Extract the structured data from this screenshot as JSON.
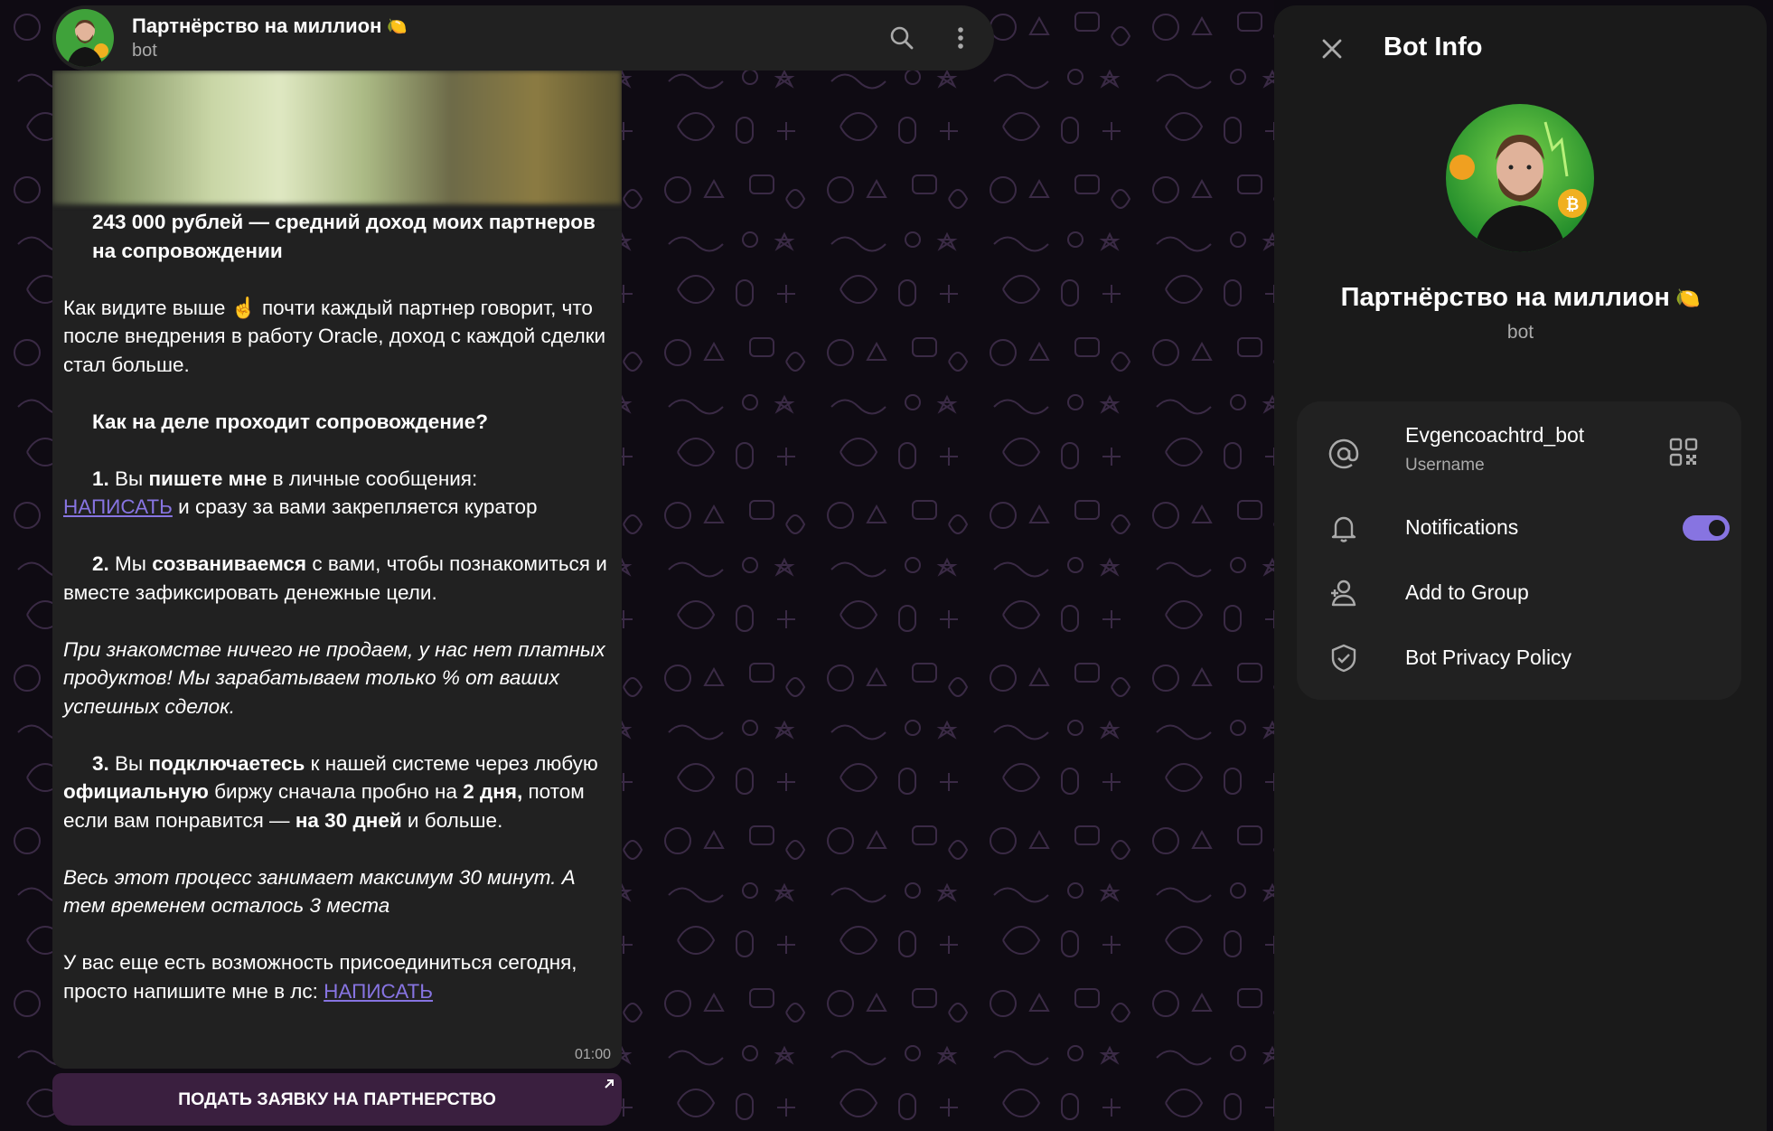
{
  "header": {
    "title": "Партнёрство на миллион",
    "title_emoji": "🍋",
    "subtitle": "bot",
    "icons": [
      "search-icon",
      "more-vertical-icon"
    ]
  },
  "message": {
    "p1": "243 000 рублей — средний доход моих партнеров на сопровождении",
    "p2a": "Как видите выше ",
    "p2_emoji": "☝️",
    "p2b": " почти каждый партнер говорит, что после внедрения в работу Oracle, доход с каждой сделки стал больше.",
    "p3": "Как на деле проходит сопровождение?",
    "p4_num": "1.",
    "p4a": " Вы ",
    "p4_bold": "пишете мне",
    "p4b": " в личные сообщения: ",
    "p4_link": "НАПИСАТЬ",
    "p4c": " и сразу за вами закрепляется куратор",
    "p5_num": "2.",
    "p5a": " Мы ",
    "p5_bold": "созваниваемся",
    "p5b": " с вами, чтобы познакомиться и вместе зафиксировать денежные цели.",
    "p6": "При знакомстве ничего не продаем, у нас нет платных продуктов! Мы зарабатываем только % от ваших успешных сделок.",
    "p7_num": "3.",
    "p7a": " Вы ",
    "p7_bold1": "подключаетесь",
    "p7b": " к нашей системе через любую ",
    "p7_bold2": "официальную",
    "p7c": " биржу сначала пробно на ",
    "p7_bold3": "2 дня,",
    "p7d": " потом если вам понравится — ",
    "p7_bold4": "на 30 дней",
    "p7e": " и больше.",
    "p8": "Весь этот процесс занимает максимум 30 минут. А тем временем осталось 3 места",
    "p9": "У вас еще есть возможность присоединиться сегодня, просто напишите мне в лс: ",
    "p9_link": "НАПИСАТЬ",
    "time": "01:00"
  },
  "keyboard": {
    "button_label": "ПОДАТЬ ЗАЯВКУ НА ПАРТНЕРСТВО"
  },
  "panel": {
    "title": "Bot Info",
    "name": "Партнёрство на миллион",
    "name_emoji": "🍋",
    "subtitle": "bot",
    "username": "Evgencoachtrd_bot",
    "username_label": "Username",
    "notifications_label": "Notifications",
    "notifications_on": true,
    "add_to_group_label": "Add to Group",
    "privacy_label": "Bot Privacy Policy",
    "accent_color": "#8774e1"
  }
}
